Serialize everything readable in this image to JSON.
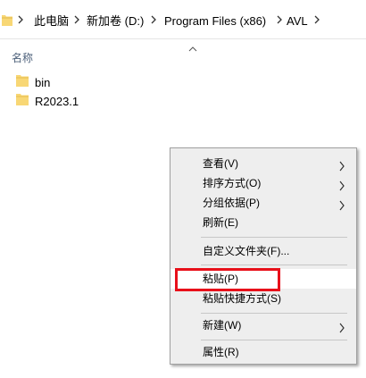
{
  "breadcrumb": {
    "items": [
      "此电脑",
      "新加卷 (D:)",
      "Program Files (x86)",
      "AVL"
    ]
  },
  "file_list": {
    "column_header": "名称",
    "files": [
      {
        "name": "bin",
        "icon": "folder-icon"
      },
      {
        "name": "R2023.1",
        "icon": "folder-icon"
      }
    ]
  },
  "context_menu": {
    "view": "查看(V)",
    "sort": "排序方式(O)",
    "group": "分组依据(P)",
    "refresh": "刷新(E)",
    "customize": "自定义文件夹(F)...",
    "paste": "粘贴(P)",
    "paste_shortcut": "粘贴快捷方式(S)",
    "new": "新建(W)",
    "properties": "属性(R)"
  },
  "colors": {
    "highlight_box": "#e8101a",
    "folder": "#f8d775",
    "menu_bg": "#eeeeee"
  }
}
